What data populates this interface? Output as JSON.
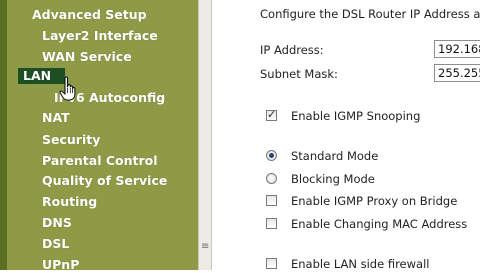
{
  "sidebar": {
    "items": [
      {
        "label": "Advanced Setup"
      },
      {
        "label": "Layer2 Interface"
      },
      {
        "label": "WAN Service"
      },
      {
        "label": "LAN",
        "selected": true
      },
      {
        "label": "IPv6 Autoconfig"
      },
      {
        "label": "NAT"
      },
      {
        "label": "Security"
      },
      {
        "label": "Parental Control"
      },
      {
        "label": "Quality of Service"
      },
      {
        "label": "Routing"
      },
      {
        "label": "DNS"
      },
      {
        "label": "DSL"
      },
      {
        "label": "UPnP"
      }
    ]
  },
  "main": {
    "intro": "Configure the DSL Router IP Address a",
    "ip_label": "IP Address:",
    "ip_value": "192.168",
    "mask_label": "Subnet Mask:",
    "mask_value": "255.255",
    "igmp_snooping_label": "Enable IGMP Snooping",
    "igmp_snooping_checked": true,
    "standard_mode_label": "Standard Mode",
    "standard_mode_selected": true,
    "blocking_mode_label": "Blocking Mode",
    "igmp_proxy_label": "Enable IGMP Proxy on Bridge",
    "mac_label": "Enable Changing MAC Address",
    "lan_firewall_label": "Enable LAN side firewall"
  },
  "colors": {
    "sidebar_bg": "#8e9a46",
    "selected_bg": "#1e4f23"
  },
  "icons": {
    "cursor": "hand-pointer-icon",
    "scroll_grip": "scroll-grip-icon"
  }
}
